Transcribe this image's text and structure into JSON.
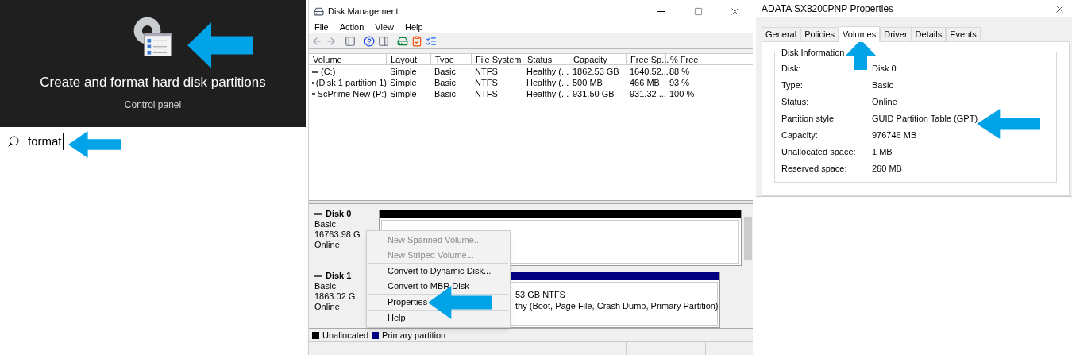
{
  "search_result": {
    "title": "Create and format hard disk partitions",
    "subtitle": "Control panel"
  },
  "search": {
    "value": "format"
  },
  "disk_management": {
    "window": {
      "title": "Disk Management"
    },
    "menu": [
      "File",
      "Action",
      "View",
      "Help"
    ],
    "table": {
      "columns": [
        "Volume",
        "Layout",
        "Type",
        "File System",
        "Status",
        "Capacity",
        "Free Sp...",
        "% Free"
      ],
      "rows": [
        {
          "cells": [
            "(C:)",
            "Simple",
            "Basic",
            "NTFS",
            "Healthy (...",
            "1862.53 GB",
            "1640.52...",
            "88 %"
          ]
        },
        {
          "cells": [
            "(Disk 1 partition 1)",
            "Simple",
            "Basic",
            "NTFS",
            "Healthy (...",
            "500 MB",
            "466 MB",
            "93 %"
          ]
        },
        {
          "cells": [
            "ScPrime New (P:)",
            "Simple",
            "Basic",
            "NTFS",
            "Healthy (...",
            "931.50 GB",
            "931.32 ...",
            "100 %"
          ]
        }
      ]
    },
    "disks": [
      {
        "name": "Disk 0",
        "type": "Basic",
        "size": "16763.98 G",
        "status": "Online",
        "partitions": [
          {
            "kind": "unallocated"
          }
        ]
      },
      {
        "name": "Disk 1",
        "type": "Basic",
        "size": "1863.02 G",
        "status": "Online",
        "partitions": [
          {
            "kind": "primary",
            "lines": [
              "53 GB NTFS",
              "thy (Boot, Page File, Crash Dump, Primary Partition)"
            ]
          }
        ]
      }
    ],
    "context_menu": {
      "groups": [
        [
          {
            "label": "New Spanned Volume...",
            "disabled": true
          },
          {
            "label": "New Striped Volume...",
            "disabled": true
          }
        ],
        [
          {
            "label": "Convert to Dynamic Disk...",
            "disabled": false
          },
          {
            "label": "Convert to MBR Disk",
            "disabled": false
          }
        ],
        [
          {
            "label": "Properties",
            "disabled": false
          }
        ],
        [
          {
            "label": "Help",
            "disabled": false
          }
        ]
      ]
    },
    "legend": [
      {
        "kind": "unallocated",
        "label": "Unallocated",
        "color": "#000000"
      },
      {
        "kind": "primary",
        "label": "Primary partition",
        "color": "#000080"
      }
    ]
  },
  "properties": {
    "window": {
      "title": "ADATA SX8200PNP Properties"
    },
    "tabs": [
      {
        "label": "General",
        "selected": false
      },
      {
        "label": "Policies",
        "selected": false
      },
      {
        "label": "Volumes",
        "selected": true
      },
      {
        "label": "Driver",
        "selected": false
      },
      {
        "label": "Details",
        "selected": false
      },
      {
        "label": "Events",
        "selected": false
      }
    ],
    "group": {
      "title": "Disk Information",
      "fields": [
        {
          "label": "Disk:",
          "value": "Disk 0"
        },
        {
          "label": "Type:",
          "value": "Basic"
        },
        {
          "label": "Status:",
          "value": "Online"
        },
        {
          "label": "Partition style:",
          "value": "GUID Partition Table (GPT)"
        },
        {
          "label": "Capacity:",
          "value": "976746 MB"
        },
        {
          "label": "Unallocated space:",
          "value": "1 MB"
        },
        {
          "label": "Reserved space:",
          "value": "260 MB"
        }
      ]
    }
  }
}
